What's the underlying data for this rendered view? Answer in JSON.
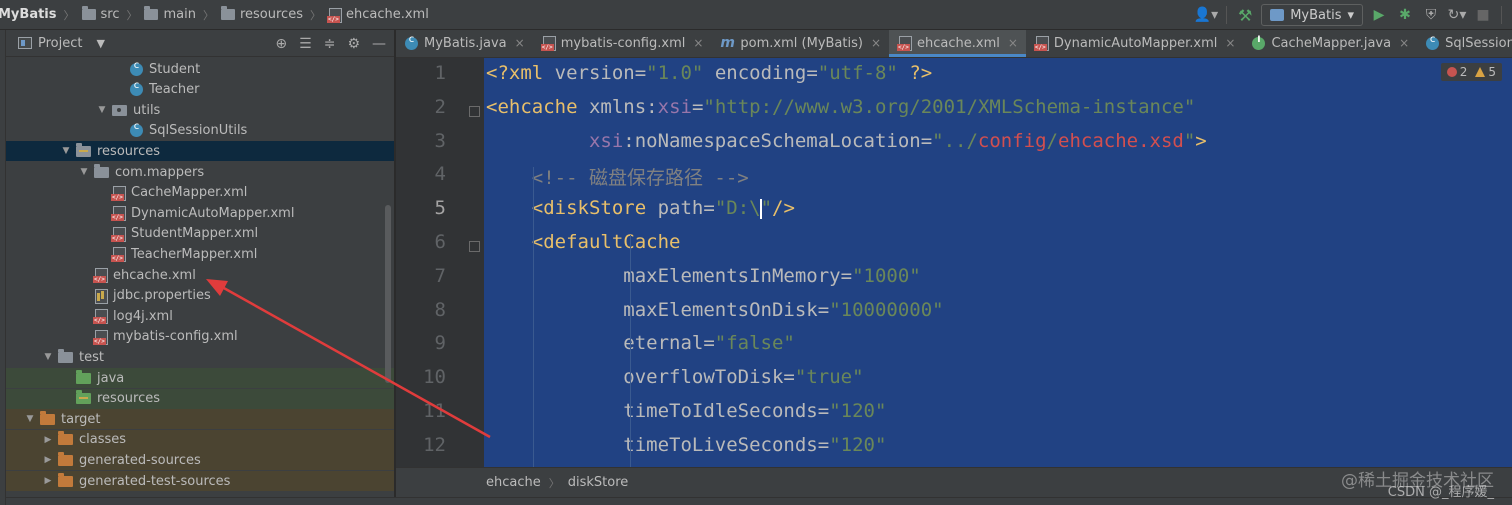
{
  "breadcrumb": [
    "MyBatis",
    "src",
    "main",
    "resources",
    "ehcache.xml"
  ],
  "toolbar": {
    "run_config": "MyBatis",
    "icons": [
      "user-icon",
      "hammer-icon",
      "run-icon",
      "debug-icon",
      "coverage-icon",
      "profile-icon",
      "stop-icon"
    ]
  },
  "project_panel": {
    "title": "Project",
    "tree": [
      {
        "label": "Student",
        "icon": "class-icon",
        "depth": 7
      },
      {
        "label": "Teacher",
        "icon": "class-icon",
        "depth": 7
      },
      {
        "label": "utils",
        "icon": "package-icon",
        "depth": 6,
        "expanded": true
      },
      {
        "label": "SqlSessionUtils",
        "icon": "class-icon",
        "depth": 7
      },
      {
        "label": "resources",
        "icon": "resources-folder-icon",
        "depth": 4,
        "expanded": true,
        "selected": true
      },
      {
        "label": "com.mappers",
        "icon": "folder-icon",
        "depth": 5,
        "expanded": true
      },
      {
        "label": "CacheMapper.xml",
        "icon": "xml-file-icon",
        "depth": 6
      },
      {
        "label": "DynamicAutoMapper.xml",
        "icon": "xml-file-icon",
        "depth": 6
      },
      {
        "label": "StudentMapper.xml",
        "icon": "xml-file-icon",
        "depth": 6
      },
      {
        "label": "TeacherMapper.xml",
        "icon": "xml-file-icon",
        "depth": 6
      },
      {
        "label": "ehcache.xml",
        "icon": "xml-file-icon",
        "depth": 5
      },
      {
        "label": "jdbc.properties",
        "icon": "properties-file-icon",
        "depth": 5
      },
      {
        "label": "log4j.xml",
        "icon": "xml-file-icon",
        "depth": 5
      },
      {
        "label": "mybatis-config.xml",
        "icon": "xml-file-icon",
        "depth": 5
      },
      {
        "label": "test",
        "icon": "folder-icon",
        "depth": 3,
        "expanded": true
      },
      {
        "label": "java",
        "icon": "test-source-folder-icon",
        "depth": 4,
        "tint": "green"
      },
      {
        "label": "resources",
        "icon": "test-resources-folder-icon",
        "depth": 4,
        "tint": "green"
      },
      {
        "label": "target",
        "icon": "excluded-folder-icon",
        "depth": 2,
        "expanded": true,
        "tint": "orange"
      },
      {
        "label": "classes",
        "icon": "excluded-folder-icon",
        "depth": 3,
        "collapsed": true,
        "tint": "orange"
      },
      {
        "label": "generated-sources",
        "icon": "excluded-folder-icon",
        "depth": 3,
        "collapsed": true,
        "tint": "orange"
      },
      {
        "label": "generated-test-sources",
        "icon": "excluded-folder-icon",
        "depth": 3,
        "collapsed": true,
        "tint": "orange"
      }
    ]
  },
  "tabs": [
    {
      "label": "MyBatis.java",
      "icon": "class-icon"
    },
    {
      "label": "mybatis-config.xml",
      "icon": "xml-file-icon"
    },
    {
      "label": "pom.xml (MyBatis)",
      "icon": "maven-icon"
    },
    {
      "label": "ehcache.xml",
      "icon": "xml-file-icon",
      "active": true
    },
    {
      "label": "DynamicAutoMapper.xml",
      "icon": "xml-file-icon"
    },
    {
      "label": "CacheMapper.java",
      "icon": "interface-icon"
    },
    {
      "label": "SqlSessionUtils.java",
      "icon": "class-icon"
    }
  ],
  "editor": {
    "line_numbers": [
      "1",
      "2",
      "3",
      "4",
      "5",
      "6",
      "7",
      "8",
      "9",
      "10",
      "11",
      "12"
    ],
    "current_line": 5,
    "errors": "2",
    "warnings": "5",
    "lines": [
      "<?xml version=\"1.0\" encoding=\"utf-8\" ?>",
      "<ehcache xmlns:xsi=\"http://www.w3.org/2001/XMLSchema-instance\"",
      "         xsi:noNamespaceSchemaLocation=\"../config/ehcache.xsd\">",
      "    <!-- 磁盘保存路径 -->",
      "    <diskStore path=\"D:\\\"/>",
      "    <defaultCache",
      "            maxElementsInMemory=\"1000\"",
      "            maxElementsOnDisk=\"10000000\"",
      "            eternal=\"false\"",
      "            overflowToDisk=\"true\"",
      "            timeToIdleSeconds=\"120\"",
      "            timeToLiveSeconds=\"120\""
    ]
  },
  "editor_breadcrumb": [
    "ehcache",
    "diskStore"
  ],
  "watermark": {
    "line1": "@稀土掘金技术社区",
    "line2": "CSDN @_程序媛_"
  },
  "colors": {
    "selection": "#214283",
    "tree_selected": "#0d293e",
    "tab_underline": "#4a88c7",
    "arrow": "#e03c3c"
  }
}
